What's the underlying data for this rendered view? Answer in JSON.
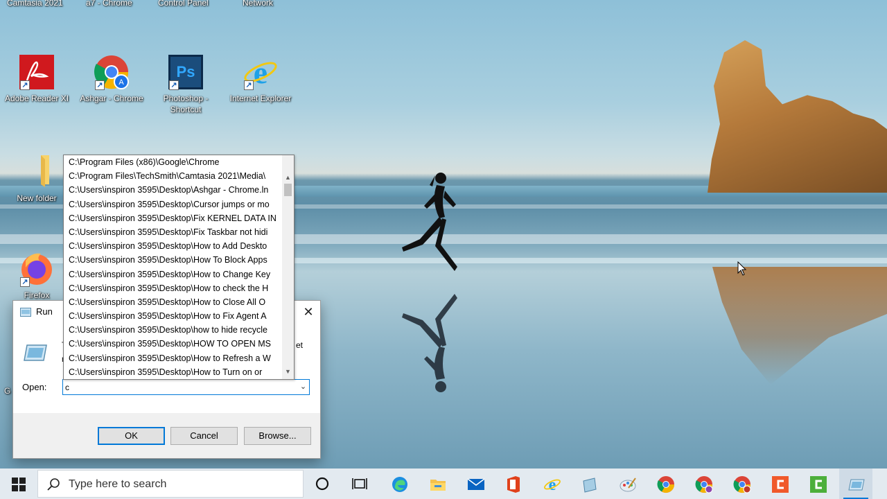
{
  "desktop": {
    "top_row_labels": [
      "Camtasia 2021",
      "a7 - Chrome",
      "Control Panel",
      "Network"
    ],
    "icons": [
      {
        "name": "adobe-reader-icon",
        "label": "Adobe Reader XI"
      },
      {
        "name": "chrome-profile-icon",
        "label": "Ashgar - Chrome"
      },
      {
        "name": "photoshop-icon",
        "label": "Photoshop - Shortcut"
      },
      {
        "name": "internet-explorer-icon",
        "label": "Internet Explorer"
      },
      {
        "name": "folder-icon",
        "label": "New folder"
      },
      {
        "name": "firefox-icon",
        "label": "Firefox"
      }
    ],
    "partial_label": "G"
  },
  "run_dialog": {
    "title": "Run",
    "close_glyph": "✕",
    "description_fragment": "T",
    "description_fragment_2": "r",
    "description_fragment_3": "et",
    "open_label": "Open:",
    "open_value": "c",
    "ok_label": "OK",
    "cancel_label": "Cancel",
    "browse_label": "Browse..."
  },
  "autocomplete": {
    "items": [
      "C:\\Program Files (x86)\\Google\\Chrome",
      "C:\\Program Files\\TechSmith\\Camtasia 2021\\Media\\",
      "C:\\Users\\inspiron 3595\\Desktop\\Ashgar - Chrome.ln",
      "C:\\Users\\inspiron 3595\\Desktop\\Cursor jumps or mo",
      "C:\\Users\\inspiron 3595\\Desktop\\Fix KERNEL DATA IN",
      "C:\\Users\\inspiron 3595\\Desktop\\Fix Taskbar not hidi",
      "C:\\Users\\inspiron 3595\\Desktop\\How to Add Deskto",
      "C:\\Users\\inspiron 3595\\Desktop\\How To Block Apps",
      "C:\\Users\\inspiron 3595\\Desktop\\How to Change Key",
      "C:\\Users\\inspiron 3595\\Desktop\\How to check the H",
      "C:\\Users\\inspiron 3595\\Desktop\\How to Close All O",
      "C:\\Users\\inspiron 3595\\Desktop\\How to Fix Agent A",
      "C:\\Users\\inspiron 3595\\Desktop\\how to hide recycle",
      "C:\\Users\\inspiron 3595\\Desktop\\HOW TO OPEN MS",
      "C:\\Users\\inspiron 3595\\Desktop\\How to Refresh a W",
      "C:\\Users\\inspiron 3595\\Desktop\\How to Turn on or"
    ]
  },
  "taskbar": {
    "search_placeholder": "Type here to search",
    "apps": [
      "cortana-icon",
      "task-view-icon",
      "edge-icon",
      "file-explorer-icon",
      "mail-icon",
      "office-icon",
      "internet-explorer-icon",
      "notepad-icon",
      "paint-icon",
      "chrome-icon",
      "chrome-profile-1-icon",
      "chrome-profile-2-icon",
      "camtasia-icon",
      "camtasia-recorder-icon",
      "run-icon"
    ]
  },
  "colors": {
    "accent": "#0078d7",
    "taskbar_bg": "#e3eaf0"
  }
}
